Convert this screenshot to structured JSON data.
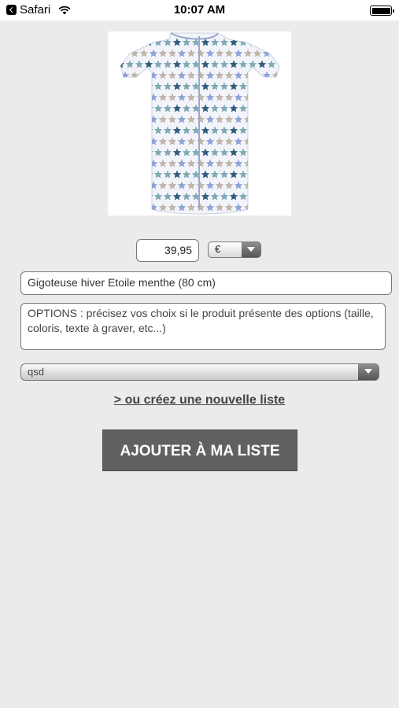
{
  "status_bar": {
    "back_app": "Safari",
    "time": "10:07 AM",
    "back_icon": "back-chevron-icon",
    "wifi_icon": "wifi-icon",
    "battery_icon": "battery-icon"
  },
  "product": {
    "image_icon": "star-sleep-sack-image",
    "price": "39,95",
    "currency": "€",
    "name": "Gigoteuse hiver Etoile menthe (80 cm)",
    "options_placeholder": "OPTIONS : précisez vos choix si le produit présente des options (taille, coloris, texte à graver, etc...)"
  },
  "list": {
    "selected": "qsd",
    "new_list_link": "> ou créez une nouvelle liste"
  },
  "actions": {
    "add_button": "AJOUTER À MA LISTE"
  },
  "colors": {
    "page_background": "#ebebeb",
    "button_background": "#616161",
    "star_navy": "#2f5d7c",
    "star_teal": "#7fa9b3",
    "star_grey": "#bfb5aa",
    "star_blue": "#8fa4d6"
  }
}
